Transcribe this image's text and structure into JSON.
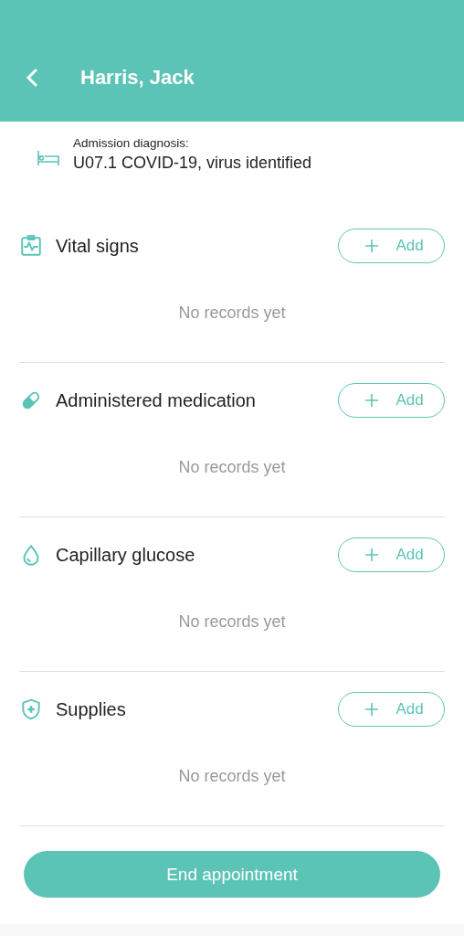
{
  "header": {
    "title": "Harris, Jack"
  },
  "diagnosis": {
    "label": "Admission diagnosis:",
    "value": "U07.1 COVID-19, virus identified"
  },
  "sections": [
    {
      "kind": "vitals",
      "title": "Vital signs",
      "add_label": "Add",
      "empty_text": "No records yet"
    },
    {
      "kind": "medication",
      "title": "Administered medication",
      "add_label": "Add",
      "empty_text": "No records yet"
    },
    {
      "kind": "glucose",
      "title": "Capillary glucose",
      "add_label": "Add",
      "empty_text": "No records yet"
    },
    {
      "kind": "supplies",
      "title": "Supplies",
      "add_label": "Add",
      "empty_text": "No records yet"
    }
  ],
  "footer_button": "End appointment"
}
